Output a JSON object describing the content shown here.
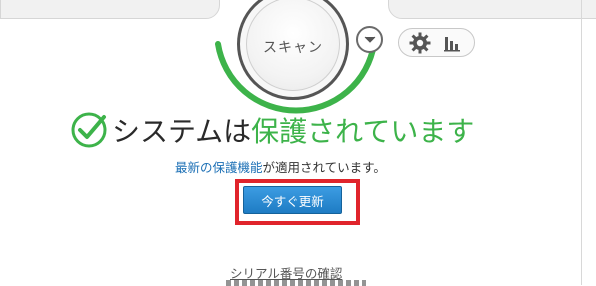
{
  "scan": {
    "label": "スキャン"
  },
  "status": {
    "prefix": "システムは",
    "highlight": "保護されています"
  },
  "info": {
    "link_text": "最新の保護機能",
    "rest_text": "が適用されています。"
  },
  "update_button": {
    "label": "今すぐ更新"
  },
  "serial": {
    "link_text": "シリアル番号の確認"
  },
  "colors": {
    "accent_green": "#3db34a",
    "link_blue": "#1b6fb5",
    "button_blue": "#1e7cc4",
    "highlight_red": "#e0242b"
  },
  "icons": [
    "check-circle-icon",
    "chevron-down-icon",
    "gear-icon",
    "bar-chart-icon"
  ]
}
